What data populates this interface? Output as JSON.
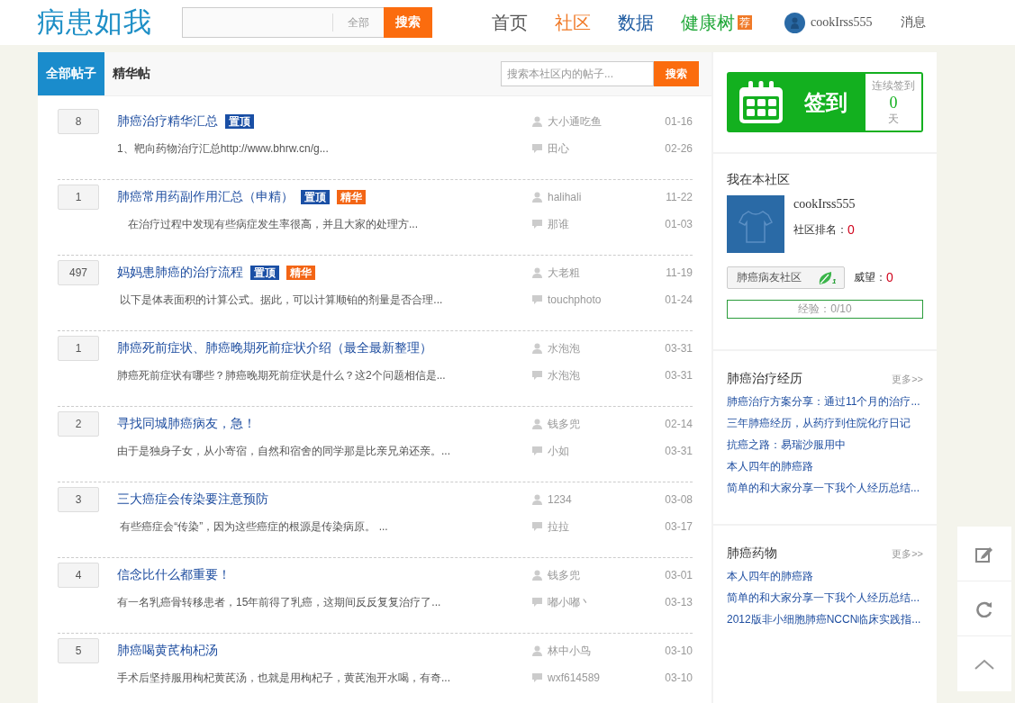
{
  "header": {
    "logo": "病患如我",
    "search": {
      "scope": "全部",
      "button": "搜索"
    },
    "nav": [
      {
        "label": "首页",
        "color": "#555555"
      },
      {
        "label": "社区",
        "color": "#f07a28"
      },
      {
        "label": "数据",
        "color": "#1d5aa0"
      },
      {
        "label": "健康树",
        "color": "#22a83a",
        "badge": "荐"
      }
    ],
    "user": "cookIrss555",
    "messages": "消息"
  },
  "tabs": [
    {
      "label": "全部帖子",
      "selected": true
    },
    {
      "label": "精华帖",
      "selected": false
    }
  ],
  "board_search": {
    "placeholder": "搜索本社区内的帖子...",
    "button": "搜索"
  },
  "posts": [
    {
      "count": "8",
      "title": "肺癌治疗精华汇总",
      "tags": [
        {
          "label": "置顶",
          "kind": "pinned"
        }
      ],
      "excerpt": "1、靶向药物治疗汇总http://www.bhrw.cn/g...",
      "author": "大小通吃鱼",
      "date": "01-16",
      "last_replier": "田心",
      "reply_date": "02-26"
    },
    {
      "count": "1",
      "title": "肺癌常用药副作用汇总（申精）",
      "tags": [
        {
          "label": "置顶",
          "kind": "pinned"
        },
        {
          "label": "精华",
          "kind": "featured"
        }
      ],
      "excerpt": "　在治疗过程中发现有些病症发生率很高，并且大家的处理方...",
      "author": "halihali",
      "date": "11-22",
      "last_replier": "那谁",
      "reply_date": "01-03"
    },
    {
      "count": "497",
      "title": "妈妈患肺癌的治疗流程",
      "tags": [
        {
          "label": "置顶",
          "kind": "pinned"
        },
        {
          "label": "精华",
          "kind": "featured"
        }
      ],
      "excerpt": " 以下是体表面积的计算公式。据此，可以计算顺铂的剂量是否合理...",
      "author": "大老粗",
      "date": "11-19",
      "last_replier": "touchphoto",
      "reply_date": "01-24"
    },
    {
      "count": "1",
      "title": "肺癌死前症状、肺癌晚期死前症状介绍（最全最新整理）",
      "excerpt": "肺癌死前症状有哪些？肺癌晚期死前症状是什么？这2个问题相信是...",
      "author": "水泡泡",
      "date": "03-31",
      "last_replier": "水泡泡",
      "reply_date": "03-31"
    },
    {
      "count": "2",
      "title": "寻找同城肺癌病友，急！",
      "excerpt": "由于是独身子女，从小寄宿，自然和宿舍的同学那是比亲兄弟还亲。...",
      "author": "钱多兜",
      "date": "02-14",
      "last_replier": "小如",
      "reply_date": "03-31"
    },
    {
      "count": "3",
      "title": "三大癌症会传染要注意预防",
      "excerpt": " 有些癌症会“传染”，因为这些癌症的根源是传染病原。 ...",
      "author": "1234",
      "date": "03-08",
      "last_replier": "拉拉",
      "reply_date": "03-17"
    },
    {
      "count": "4",
      "title": "信念比什么都重要！",
      "excerpt": "有一名乳癌骨转移患者，15年前得了乳癌，这期间反反复复治疗了...",
      "author": "钱多兜",
      "date": "03-01",
      "last_replier": "嘟小嘟丶",
      "reply_date": "03-13"
    },
    {
      "count": "5",
      "title": "肺癌喝黄芪枸杞汤",
      "excerpt": "手术后坚持服用枸杞黄芪汤，也就是用枸杞子，黄芪泡开水喝，有奇...",
      "author": "林中小鸟",
      "date": "03-10",
      "last_replier": "wxf614589",
      "reply_date": "03-10"
    }
  ],
  "checkin": {
    "button": "签到",
    "label": "连续签到",
    "days": "0",
    "unit": "天"
  },
  "my_community": {
    "title": "我在本社区",
    "username": "cookIrss555",
    "rank_label": "社区排名：",
    "rank": "0",
    "community": "肺癌病友社区",
    "leaf_level": "1",
    "prestige_label": "威望：",
    "prestige": "0",
    "experience": "经验：0/10",
    "level": 0
  },
  "sections": [
    {
      "title": "肺癌治疗经历",
      "more": "更多>>",
      "links": [
        "肺癌治疗方案分享：通过11个月的治疗...",
        "三年肺癌经历，从药疗到住院化疗日记",
        "抗癌之路：易瑞沙服用中",
        "本人四年的肺癌路",
        "简单的和大家分享一下我个人经历总结..."
      ]
    },
    {
      "title": "肺癌药物",
      "more": "更多>>",
      "links": [
        "本人四年的肺癌路",
        "简单的和大家分享一下我个人经历总结...",
        "2012版非小细胞肺癌NCCN临床实践指..."
      ]
    }
  ]
}
